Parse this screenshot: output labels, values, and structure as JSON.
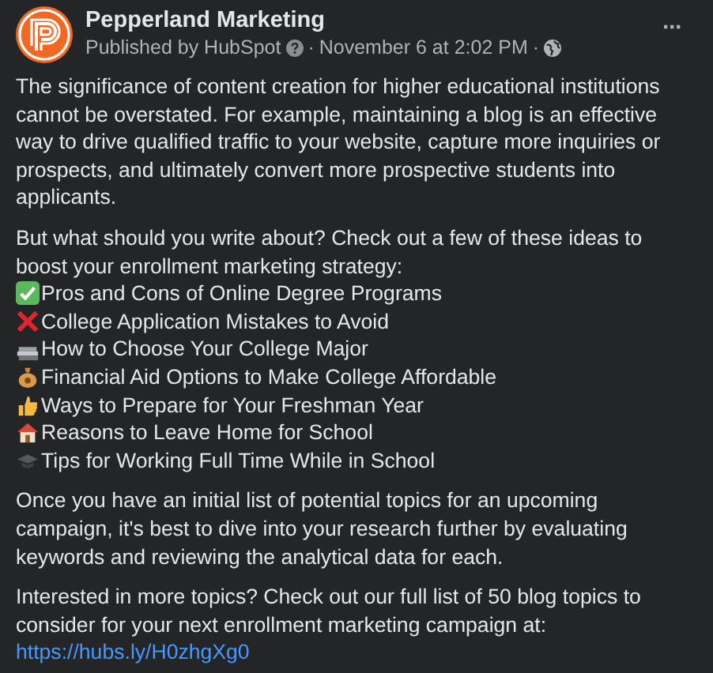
{
  "post": {
    "author": "Pepperland Marketing",
    "published_by": "Published by HubSpot",
    "separator_1": "·",
    "date": "November 6 at 2:02 PM",
    "separator_2": "·",
    "more_button": "···"
  },
  "paragraphs": [
    "The significance of content creation for higher educational institutions cannot be overstated. For example, maintaining a blog is an effective way to drive qualified traffic to your website, capture more inquiries or prospects, and ultimately convert more prospective students into applicants.",
    "But what should you write about? Check out a few of these ideas to boost your enrollment marketing strategy:"
  ],
  "ideas": [
    {
      "kind": "check",
      "text": "Pros and Cons of Online Degree Programs"
    },
    {
      "kind": "cross",
      "text": "College Application Mistakes to Avoid"
    },
    {
      "kind": "books",
      "text": "How to Choose Your College Major"
    },
    {
      "kind": "moneybag",
      "text": "Financial Aid Options to Make College Affordable"
    },
    {
      "kind": "thumbsup",
      "text": "Ways to Prepare for Your Freshman Year"
    },
    {
      "kind": "house",
      "text": "Reasons to Leave Home for School"
    },
    {
      "kind": "gradcap",
      "text": "Tips for Working Full Time While in School"
    }
  ],
  "closing_paragraphs": [
    "Once you have an initial list of potential topics for an upcoming campaign, it's best to dive into your research further by evaluating keywords and reviewing the analytical data for each.",
    "Interested in more topics? Check out our full list of 50 blog topics to consider for your next enrollment marketing campaign at:"
  ],
  "link": "https://hubs.ly/H0zhgXg0"
}
